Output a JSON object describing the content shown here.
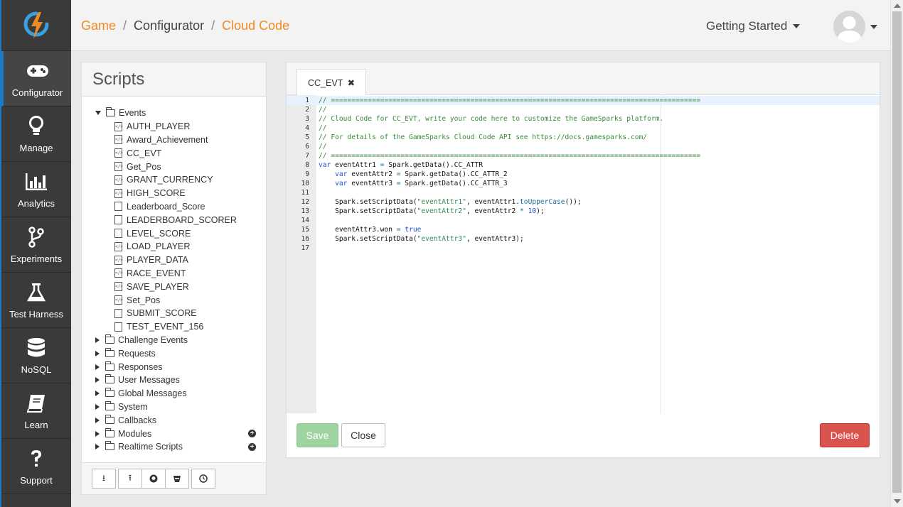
{
  "brand": {
    "logo_icon": "gamesparks-bolt-logo",
    "accent": "#1f7ac5",
    "orange": "#f08a24"
  },
  "sidebar": {
    "items": [
      {
        "label": "Configurator",
        "icon": "gamepad-icon",
        "active": true
      },
      {
        "label": "Manage",
        "icon": "lightbulb-icon"
      },
      {
        "label": "Analytics",
        "icon": "bar-chart-icon"
      },
      {
        "label": "Experiments",
        "icon": "branch-icon"
      },
      {
        "label": "Test Harness",
        "icon": "flask-icon"
      },
      {
        "label": "NoSQL",
        "icon": "database-icon"
      },
      {
        "label": "Learn",
        "icon": "book-icon"
      },
      {
        "label": "Support",
        "icon": "question-icon"
      }
    ]
  },
  "header": {
    "breadcrumb": [
      "Game",
      "Configurator",
      "Cloud Code"
    ],
    "menu_label": "Getting Started"
  },
  "scripts": {
    "title": "Scripts",
    "events_folder": "Events",
    "event_files": [
      "AUTH_PLAYER",
      "Award_Achievement",
      "CC_EVT",
      "Get_Pos",
      "GRANT_CURRENCY",
      "HIGH_SCORE",
      "Leaderboard_Score",
      "LEADERBOARD_SCORER",
      "LEVEL_SCORE",
      "LOAD_PLAYER",
      "PLAYER_DATA",
      "RACE_EVENT",
      "SAVE_PLAYER",
      "Set_Pos",
      "SUBMIT_SCORE",
      "TEST_EVENT_156"
    ],
    "folders": [
      "Challenge Events",
      "Requests",
      "Responses",
      "User Messages",
      "Global Messages",
      "System",
      "Callbacks",
      "Modules",
      "Realtime Scripts"
    ]
  },
  "editor": {
    "tab_label": "CC_EVT",
    "lines": [
      "// ==========================================================================================",
      "//",
      "// Cloud Code for CC_EVT, write your code here to customize the GameSparks platform.",
      "//",
      "// For details of the GameSparks Cloud Code API see https://docs.gamesparks.com/",
      "//",
      "// ==========================================================================================",
      "var eventAttr1 = Spark.getData().CC_ATTR",
      "    var eventAttr2 = Spark.getData().CC_ATTR_2",
      "    var eventAttr3 = Spark.getData().CC_ATTR_3",
      "",
      "    Spark.setScriptData(\"eventAttr1\", eventAttr1.toUpperCase());",
      "    Spark.setScriptData(\"eventAttr2\", eventAttr2 * 10);",
      "",
      "    eventAttr3.won = true",
      "    Spark.setScriptData(\"eventAttr3\", eventAttr3);",
      ""
    ],
    "save_label": "Save",
    "close_label": "Close",
    "delete_label": "Delete"
  }
}
